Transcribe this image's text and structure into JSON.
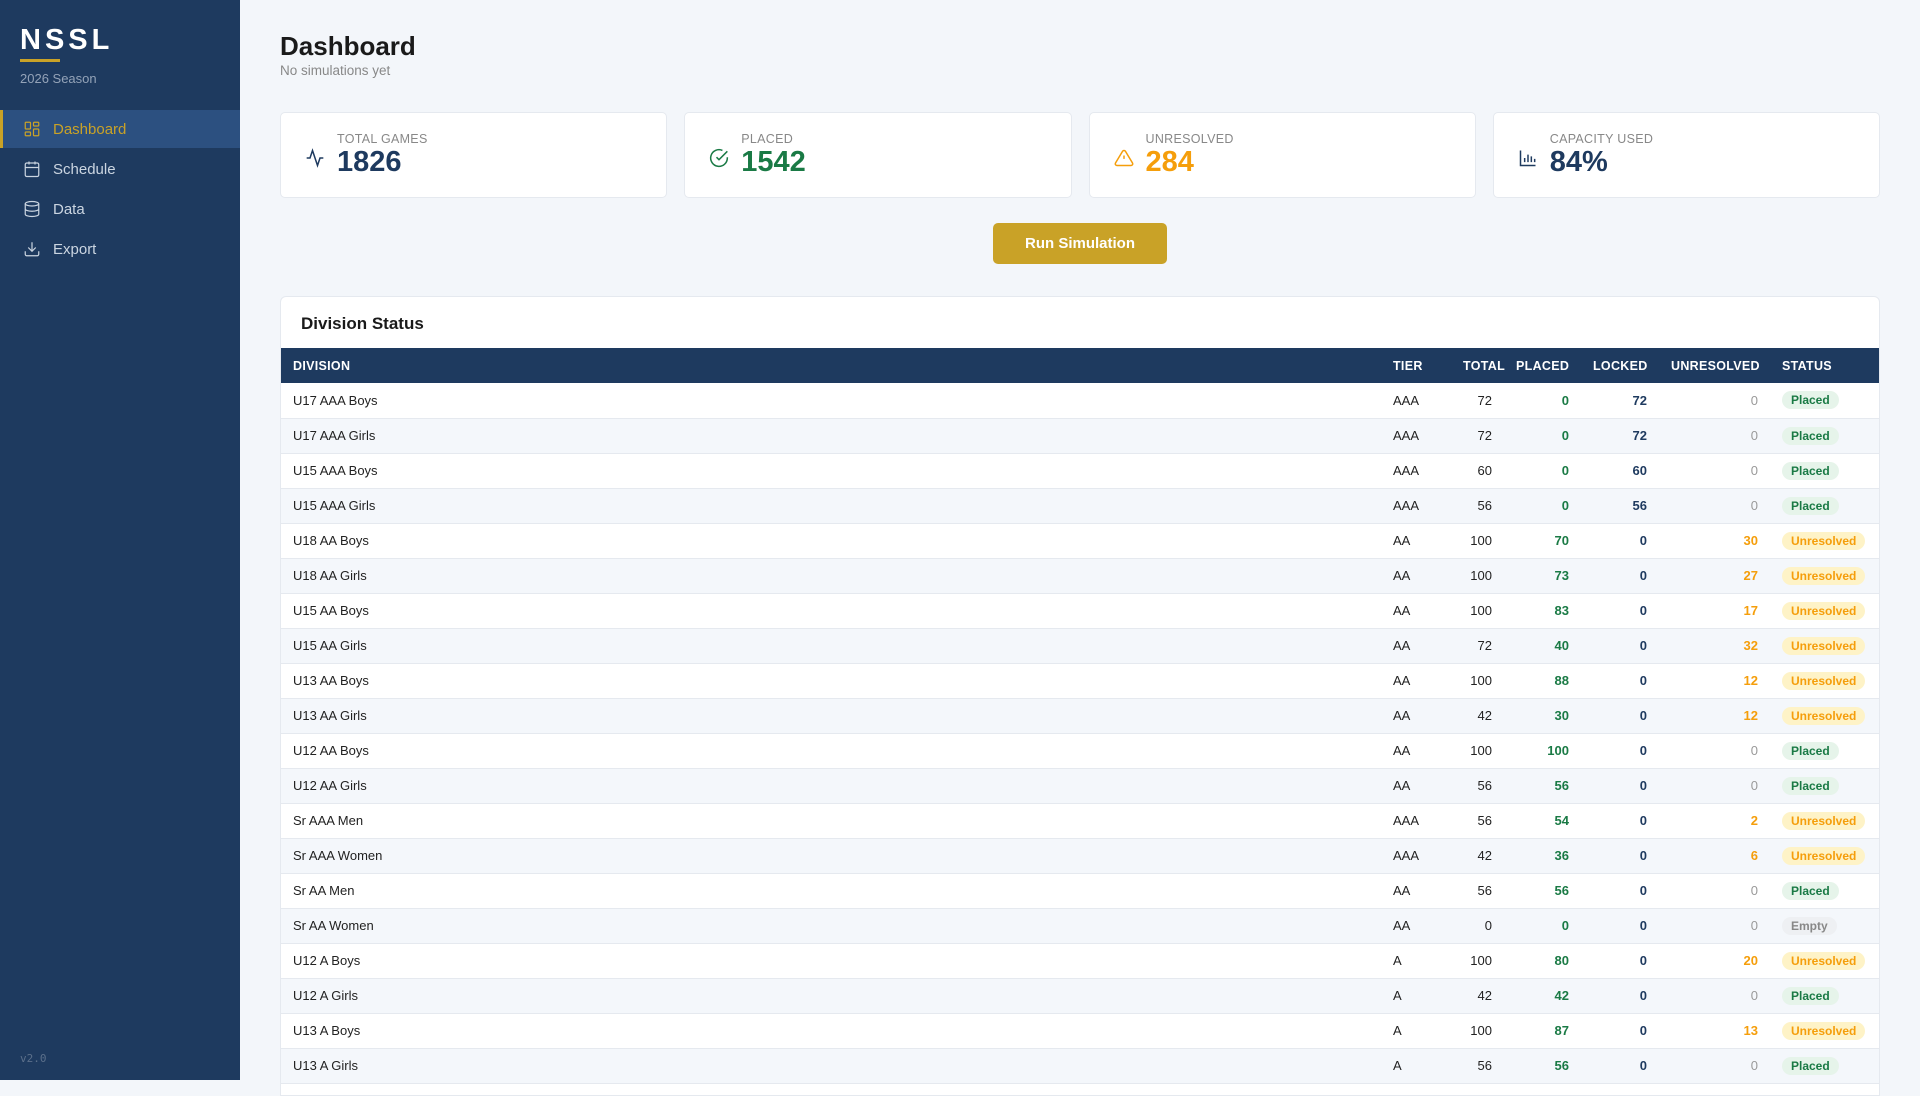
{
  "sidebar": {
    "logo": "NSSL",
    "season": "2026 Season",
    "version": "v2.0",
    "items": [
      {
        "label": "Dashboard",
        "icon": "dashboard-icon"
      },
      {
        "label": "Schedule",
        "icon": "calendar-icon"
      },
      {
        "label": "Data",
        "icon": "database-icon"
      },
      {
        "label": "Export",
        "icon": "download-icon"
      }
    ]
  },
  "header": {
    "title": "Dashboard",
    "subtitle": "No simulations yet"
  },
  "stats": [
    {
      "label": "TOTAL GAMES",
      "value": "1826",
      "color": "#1e3a5f"
    },
    {
      "label": "PLACED",
      "value": "1542",
      "color": "#1a7a45"
    },
    {
      "label": "UNRESOLVED",
      "value": "284",
      "color": "#f59e0b"
    },
    {
      "label": "CAPACITY USED",
      "value": "84%",
      "color": "#1e3a5f"
    }
  ],
  "run_button": "Run Simulation",
  "table": {
    "title": "Division Status",
    "columns": [
      "DIVISION",
      "TIER",
      "TOTAL",
      "PLACED",
      "LOCKED",
      "UNRESOLVED",
      "STATUS"
    ],
    "rows": [
      [
        "U17 AAA Boys",
        "AAA",
        "72",
        "0",
        "72",
        "0",
        "Placed"
      ],
      [
        "U17 AAA Girls",
        "AAA",
        "72",
        "0",
        "72",
        "0",
        "Placed"
      ],
      [
        "U15 AAA Boys",
        "AAA",
        "60",
        "0",
        "60",
        "0",
        "Placed"
      ],
      [
        "U15 AAA Girls",
        "AAA",
        "56",
        "0",
        "56",
        "0",
        "Placed"
      ],
      [
        "U18 AA Boys",
        "AA",
        "100",
        "70",
        "0",
        "30",
        "Unresolved"
      ],
      [
        "U18 AA Girls",
        "AA",
        "100",
        "73",
        "0",
        "27",
        "Unresolved"
      ],
      [
        "U15 AA Boys",
        "AA",
        "100",
        "83",
        "0",
        "17",
        "Unresolved"
      ],
      [
        "U15 AA Girls",
        "AA",
        "72",
        "40",
        "0",
        "32",
        "Unresolved"
      ],
      [
        "U13 AA Boys",
        "AA",
        "100",
        "88",
        "0",
        "12",
        "Unresolved"
      ],
      [
        "U13 AA Girls",
        "AA",
        "42",
        "30",
        "0",
        "12",
        "Unresolved"
      ],
      [
        "U12 AA Boys",
        "AA",
        "100",
        "100",
        "0",
        "0",
        "Placed"
      ],
      [
        "U12 AA Girls",
        "AA",
        "56",
        "56",
        "0",
        "0",
        "Placed"
      ],
      [
        "Sr AAA Men",
        "AAA",
        "56",
        "54",
        "0",
        "2",
        "Unresolved"
      ],
      [
        "Sr AAA Women",
        "AAA",
        "42",
        "36",
        "0",
        "6",
        "Unresolved"
      ],
      [
        "Sr AA Men",
        "AA",
        "56",
        "56",
        "0",
        "0",
        "Placed"
      ],
      [
        "Sr AA Women",
        "AA",
        "0",
        "0",
        "0",
        "0",
        "Empty"
      ],
      [
        "U12 A Boys",
        "A",
        "100",
        "80",
        "0",
        "20",
        "Unresolved"
      ],
      [
        "U12 A Girls",
        "A",
        "42",
        "42",
        "0",
        "0",
        "Placed"
      ],
      [
        "U13 A Boys",
        "A",
        "100",
        "87",
        "0",
        "13",
        "Unresolved"
      ],
      [
        "U13 A Girls",
        "A",
        "56",
        "56",
        "0",
        "0",
        "Placed"
      ]
    ]
  }
}
